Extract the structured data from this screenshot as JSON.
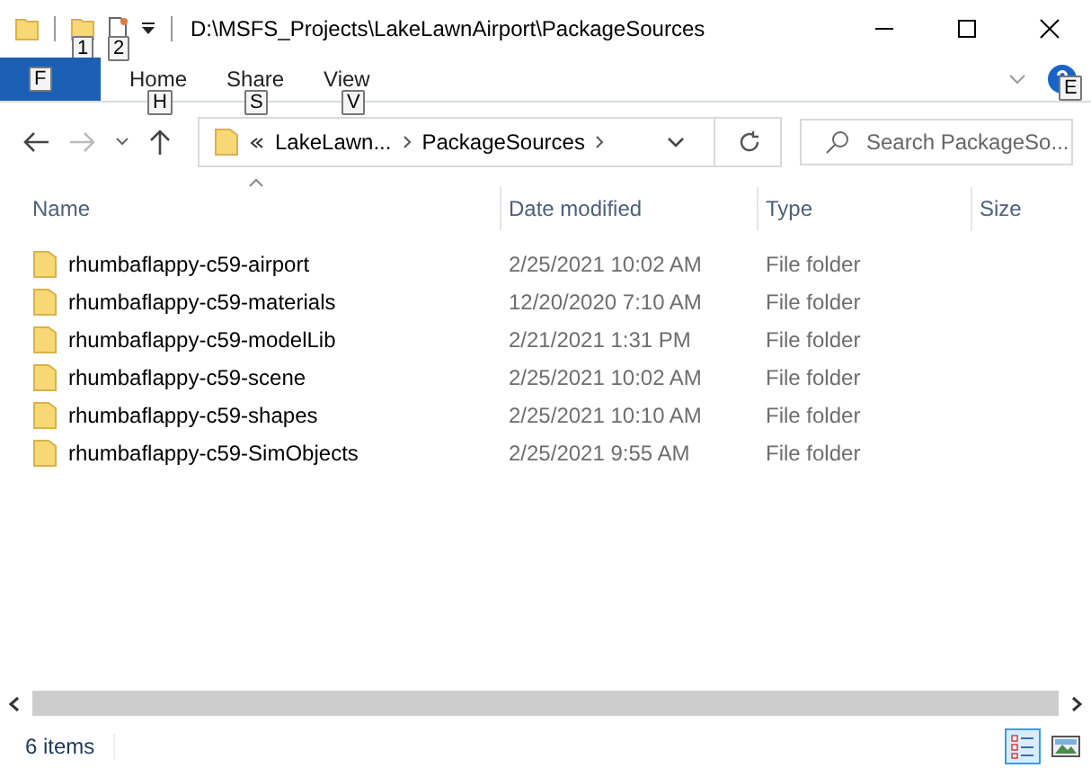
{
  "title_bar": {
    "path": "D:\\MSFS_Projects\\LakeLawnAirport\\PackageSources",
    "keytips": [
      "1",
      "2"
    ]
  },
  "ribbon": {
    "file_keytip": "F",
    "tabs": [
      {
        "label": "Home",
        "keytip": "H"
      },
      {
        "label": "Share",
        "keytip": "S"
      },
      {
        "label": "View",
        "keytip": "V"
      }
    ],
    "help_keytip": "E"
  },
  "address_bar": {
    "crumbs": [
      "LakeLawn...",
      "PackageSources"
    ]
  },
  "search": {
    "placeholder": "Search PackageSo..."
  },
  "columns": [
    "Name",
    "Date modified",
    "Type",
    "Size"
  ],
  "rows": [
    {
      "name": "rhumbaflappy-c59-airport",
      "date": "2/25/2021 10:02 AM",
      "type": "File folder"
    },
    {
      "name": "rhumbaflappy-c59-materials",
      "date": "12/20/2020 7:10 AM",
      "type": "File folder"
    },
    {
      "name": "rhumbaflappy-c59-modelLib",
      "date": "2/21/2021 1:31 PM",
      "type": "File folder"
    },
    {
      "name": "rhumbaflappy-c59-scene",
      "date": "2/25/2021 10:02 AM",
      "type": "File folder"
    },
    {
      "name": "rhumbaflappy-c59-shapes",
      "date": "2/25/2021 10:10 AM",
      "type": "File folder"
    },
    {
      "name": "rhumbaflappy-c59-SimObjects",
      "date": "2/25/2021 9:55 AM",
      "type": "File folder"
    }
  ],
  "status_bar": {
    "count": "6 items",
    "views": [
      {
        "kind": "details",
        "selected": true
      },
      {
        "kind": "preview",
        "selected": false
      }
    ]
  }
}
